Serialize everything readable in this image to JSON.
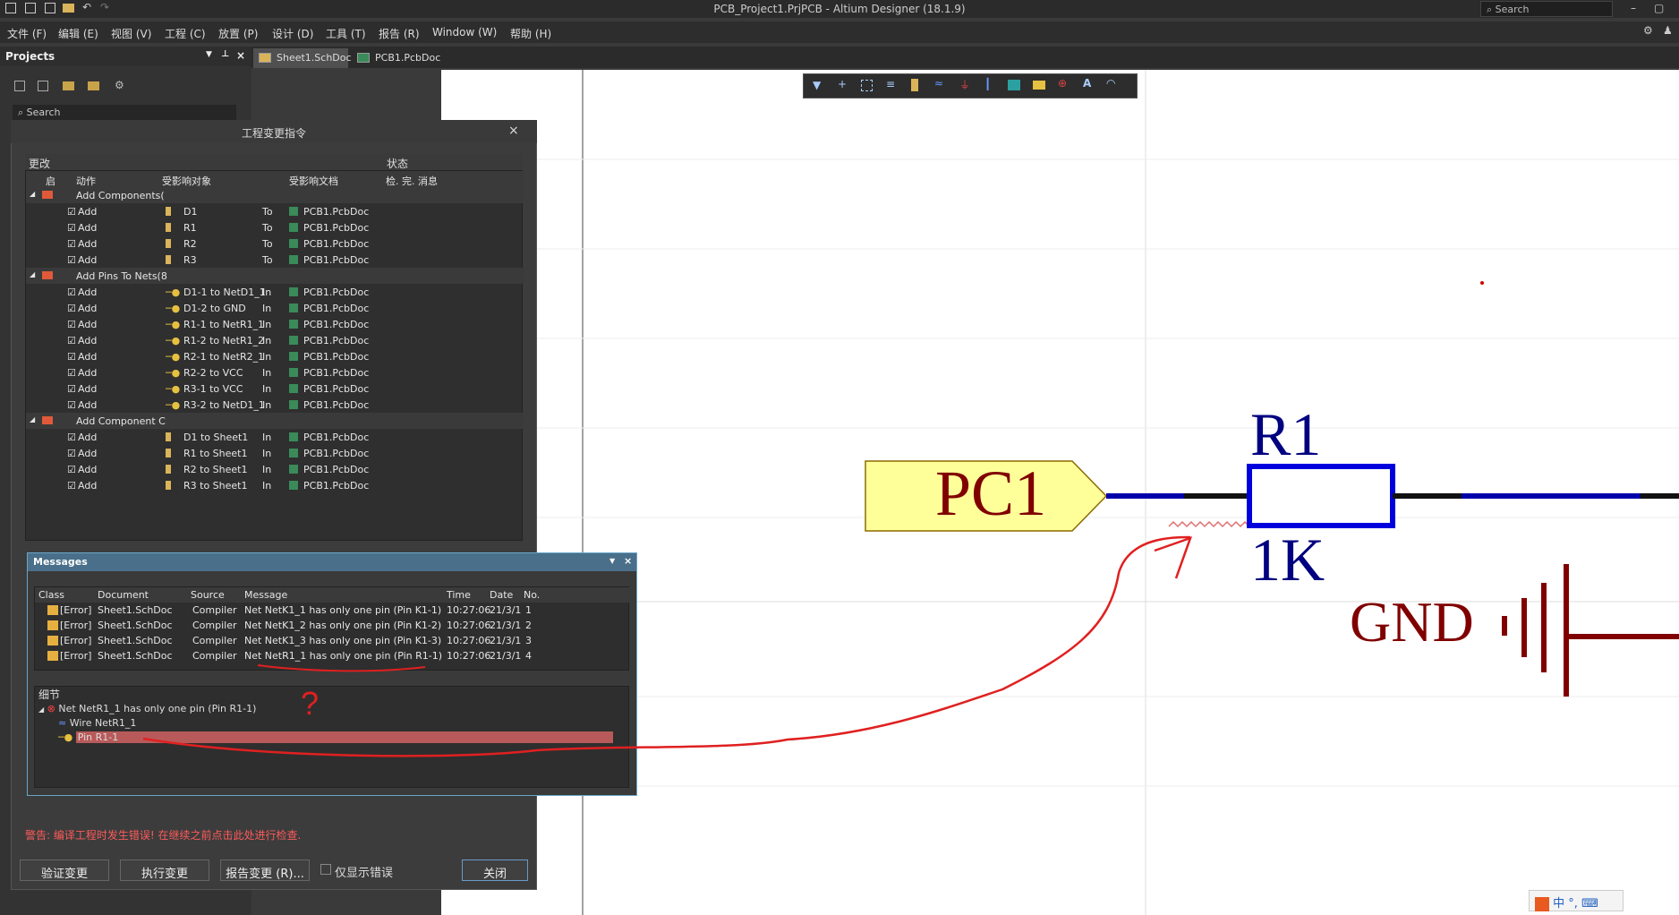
{
  "window": {
    "title": "PCB_Project1.PrjPCB - Altium Designer (18.1.9)",
    "search_placeholder": "Search"
  },
  "menu": [
    "文件 (F)",
    "编辑 (E)",
    "视图 (V)",
    "工程 (C)",
    "放置 (P)",
    "设计 (D)",
    "工具 (T)",
    "报告 (R)",
    "Window (W)",
    "帮助 (H)"
  ],
  "projects": {
    "title": "Projects",
    "search_placeholder": "Search"
  },
  "tabs": [
    "Sheet1.SchDoc",
    "PCB1.PcbDoc"
  ],
  "eco": {
    "title": "工程变更指令",
    "section_changes": "更改",
    "section_status": "状态",
    "col_enable": "启",
    "col_action": "动作",
    "col_object": "受影响对象",
    "col_doc": "受影响文档",
    "col_status": "检. 完. 消息",
    "groups": [
      {
        "label": "Add Components(",
        "rows": [
          {
            "action": "Add",
            "object": "D1",
            "dir": "To",
            "doc": "PCB1.PcbDoc"
          },
          {
            "action": "Add",
            "object": "R1",
            "dir": "To",
            "doc": "PCB1.PcbDoc"
          },
          {
            "action": "Add",
            "object": "R2",
            "dir": "To",
            "doc": "PCB1.PcbDoc"
          },
          {
            "action": "Add",
            "object": "R3",
            "dir": "To",
            "doc": "PCB1.PcbDoc"
          }
        ]
      },
      {
        "label": "Add Pins To Nets(8",
        "rows": [
          {
            "action": "Add",
            "object": "D1-1 to NetD1_1",
            "dir": "In",
            "doc": "PCB1.PcbDoc"
          },
          {
            "action": "Add",
            "object": "D1-2 to GND",
            "dir": "In",
            "doc": "PCB1.PcbDoc"
          },
          {
            "action": "Add",
            "object": "R1-1 to NetR1_1",
            "dir": "In",
            "doc": "PCB1.PcbDoc"
          },
          {
            "action": "Add",
            "object": "R1-2 to NetR1_2",
            "dir": "In",
            "doc": "PCB1.PcbDoc"
          },
          {
            "action": "Add",
            "object": "R2-1 to NetR2_1",
            "dir": "In",
            "doc": "PCB1.PcbDoc"
          },
          {
            "action": "Add",
            "object": "R2-2 to VCC",
            "dir": "In",
            "doc": "PCB1.PcbDoc"
          },
          {
            "action": "Add",
            "object": "R3-1 to VCC",
            "dir": "In",
            "doc": "PCB1.PcbDoc"
          },
          {
            "action": "Add",
            "object": "R3-2 to NetD1_1",
            "dir": "In",
            "doc": "PCB1.PcbDoc"
          }
        ]
      },
      {
        "label": "Add Component C",
        "rows": [
          {
            "action": "Add",
            "object": "D1 to Sheet1",
            "dir": "In",
            "doc": "PCB1.PcbDoc"
          },
          {
            "action": "Add",
            "object": "R1 to Sheet1",
            "dir": "In",
            "doc": "PCB1.PcbDoc"
          },
          {
            "action": "Add",
            "object": "R2 to Sheet1",
            "dir": "In",
            "doc": "PCB1.PcbDoc"
          },
          {
            "action": "Add",
            "object": "R3 to Sheet1",
            "dir": "In",
            "doc": "PCB1.PcbDoc"
          }
        ]
      }
    ],
    "warning": "警告: 编译工程时发生错误! 在继续之前点击此处进行检查.",
    "btn_validate": "验证变更",
    "btn_execute": "执行变更",
    "btn_report": "报告变更 (R)...",
    "only_errors": "仅显示错误",
    "btn_close": "关闭"
  },
  "messages": {
    "title": "Messages",
    "cols": [
      "Class",
      "Document",
      "Source",
      "Message",
      "Time",
      "Date",
      "No."
    ],
    "rows": [
      {
        "cls": "[Error]",
        "doc": "Sheet1.SchDoc",
        "src": "Compiler",
        "msg": "Net NetK1_1 has only one pin (Pin K1-1)",
        "time": "10:27:06",
        "date": "21/3/1",
        "no": "1"
      },
      {
        "cls": "[Error]",
        "doc": "Sheet1.SchDoc",
        "src": "Compiler",
        "msg": "Net NetK1_2 has only one pin (Pin K1-2)",
        "time": "10:27:06",
        "date": "21/3/1",
        "no": "2"
      },
      {
        "cls": "[Error]",
        "doc": "Sheet1.SchDoc",
        "src": "Compiler",
        "msg": "Net NetK1_3 has only one pin (Pin K1-3)",
        "time": "10:27:06",
        "date": "21/3/1",
        "no": "3"
      },
      {
        "cls": "[Error]",
        "doc": "Sheet1.SchDoc",
        "src": "Compiler",
        "msg": "Net NetR1_1 has only one pin (Pin R1-1)",
        "time": "10:27:06",
        "date": "21/3/1",
        "no": "4"
      }
    ],
    "details_title": "细节",
    "detail_root": "Net NetR1_1 has only one pin (Pin R1-1)",
    "detail_wire": "Wire NetR1_1",
    "detail_pin": "Pin R1-1",
    "annotation_mark": "?"
  },
  "schematic": {
    "port": "PC1",
    "res_ref": "R1",
    "res_val": "1K",
    "gnd": "GND"
  },
  "ime": {
    "label": "中"
  }
}
